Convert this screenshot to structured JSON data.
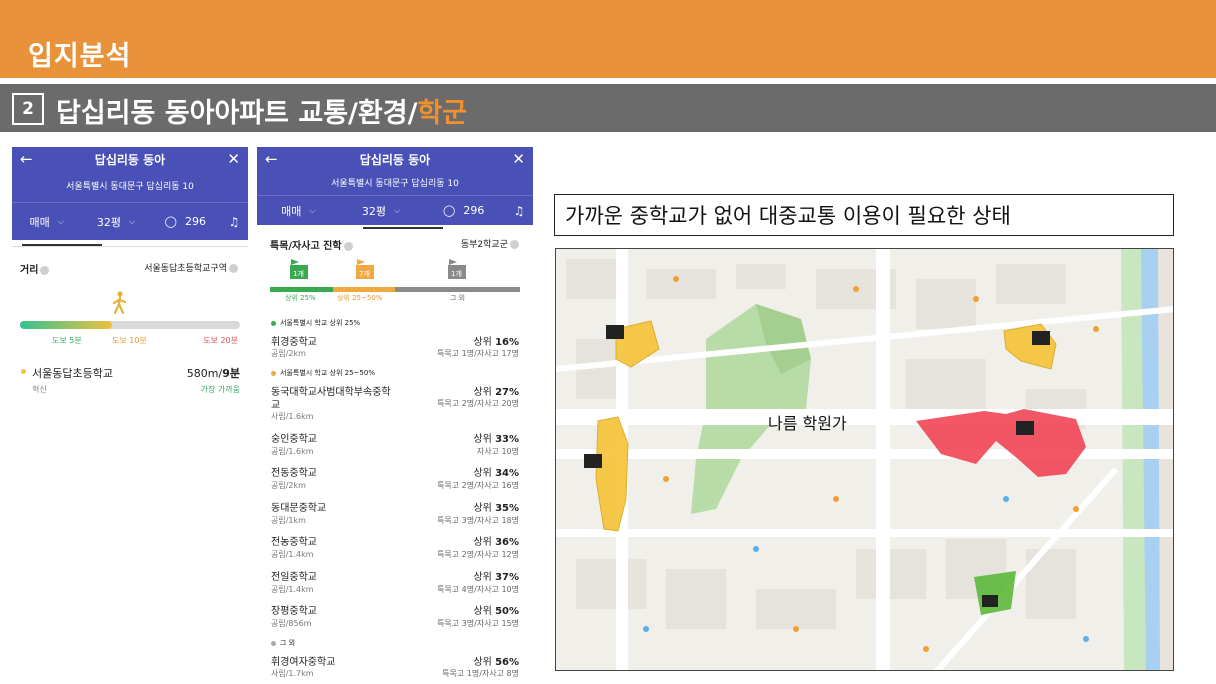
{
  "header": {
    "title": "입지분석",
    "num": "2",
    "sub_title_main": "답십리동 동아아파트 교통/환경/",
    "sub_title_highlight": "학군"
  },
  "colors": {
    "orange": "#e8923a",
    "gray_bar": "#6b6b6b",
    "app_blue": "#4950b6",
    "highlight": "#f0902e"
  },
  "phone_common": {
    "title": "답십리동 동아",
    "address": "서울특별시 동대문구 답십리동 10",
    "tab_trade": "매매",
    "tab_size": "32평",
    "tab_comments": "296"
  },
  "panel1": {
    "distance_label": "거리",
    "zone": "서울동답초등학교구역",
    "walk_5": "도보 5분",
    "walk_10": "도보 10분",
    "walk_20": "도보 20분",
    "school": "서울동답초등학교",
    "school_sub": "혁신",
    "dist_time_a": "580m/",
    "dist_time_b": "9분",
    "nearest": "가장 가까움",
    "walk_fraction": 0.42
  },
  "panel2": {
    "section_label": "특목/자사고 진학",
    "district": "동부2학교군",
    "flag1": "1개",
    "flag2": "7개",
    "flag3": "1개",
    "seg1": "상위 25%",
    "seg2": "상위 25~50%",
    "seg3": "그 외",
    "group1": "서울특별시 학교 상위 25%",
    "group2": "서울특별시 학교 상위 25~50%",
    "group3": "그 외",
    "schools": [
      {
        "name": "휘경중학교",
        "sub": "공립/2km",
        "rank_prefix": "상위 ",
        "rank": "16%",
        "count": "특목고 1명/자사고 17명"
      },
      {
        "name": "동국대학교사범대학부속중학",
        "name2": "교",
        "sub": "사립/1.6km",
        "rank_prefix": "상위 ",
        "rank": "27%",
        "count": "특목고 2명/자사고 20명"
      },
      {
        "name": "숭인중학교",
        "sub": "공립/1.6km",
        "rank_prefix": "상위 ",
        "rank": "33%",
        "count": "자사고 10명"
      },
      {
        "name": "전동중학교",
        "sub": "공립/2km",
        "rank_prefix": "상위 ",
        "rank": "34%",
        "count": "특목고 2명/자사고 16명"
      },
      {
        "name": "동대문중학교",
        "sub": "공립/1km",
        "rank_prefix": "상위 ",
        "rank": "35%",
        "count": "특목고 3명/자사고 18명"
      },
      {
        "name": "전농중학교",
        "sub": "공립/1.4km",
        "rank_prefix": "상위 ",
        "rank": "36%",
        "count": "특목고 2명/자사고 12명"
      },
      {
        "name": "전일중학교",
        "sub": "공립/1.4km",
        "rank_prefix": "상위 ",
        "rank": "37%",
        "count": "특목고 4명/자사고 10명"
      },
      {
        "name": "장평중학교",
        "sub": "공립/856m",
        "rank_prefix": "상위 ",
        "rank": "50%",
        "count": "특목고 3명/자사고 15명"
      },
      {
        "name": "휘경여자중학교",
        "sub": "사립/1.7km",
        "rank_prefix": "상위 ",
        "rank": "56%",
        "count": "특목고 1명/자사고 8명"
      }
    ]
  },
  "caption": "가까운 중학교가 없어 대중교통 이용이 필요한 상태",
  "map": {
    "label": "나름 학원가"
  }
}
